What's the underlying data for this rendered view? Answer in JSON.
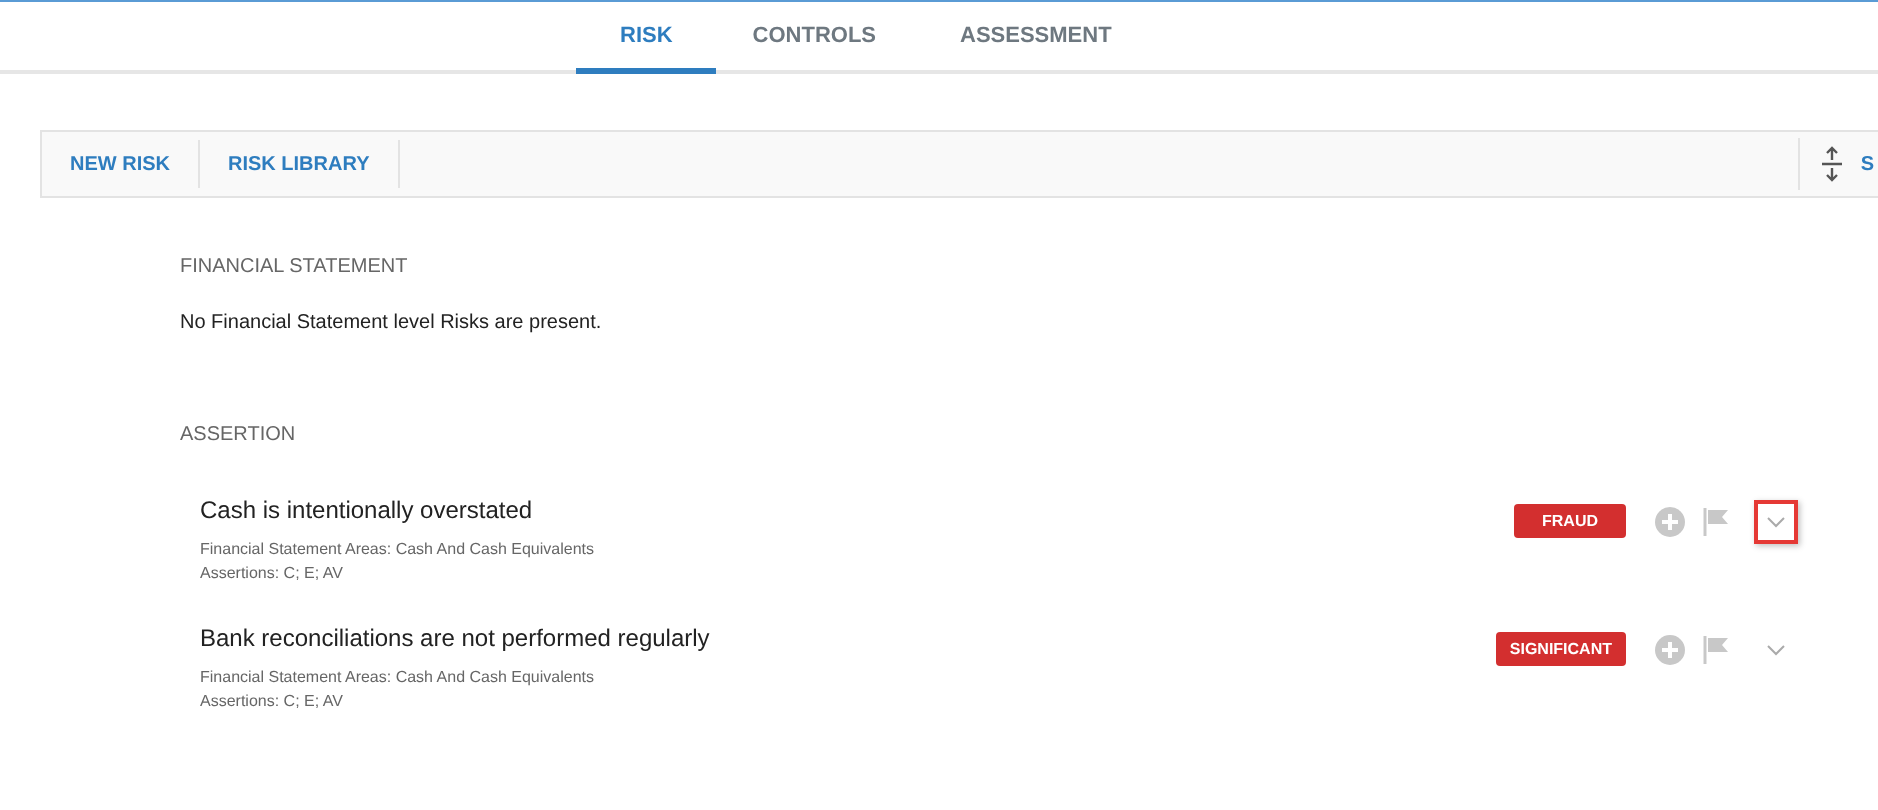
{
  "tabs": [
    {
      "label": "RISK",
      "selected": true
    },
    {
      "label": "CONTROLS",
      "selected": false
    },
    {
      "label": "ASSESSMENT",
      "selected": false
    }
  ],
  "toolbar": {
    "actions": [
      "NEW RISK",
      "RISK LIBRARY"
    ],
    "right_label": "S"
  },
  "financial_statement": {
    "heading": "FINANCIAL STATEMENT",
    "message": "No Financial Statement level Risks are present."
  },
  "assertion": {
    "heading": "ASSERTION",
    "risks": [
      {
        "title": "Cash is intentionally overstated",
        "areas": "Financial Statement Areas: Cash And Cash Equivalents",
        "assertions": "Assertions: C; E; AV",
        "badge": "FRAUD",
        "highlighted": true
      },
      {
        "title": "Bank reconciliations are not performed regularly",
        "areas": "Financial Statement Areas: Cash And Cash Equivalents",
        "assertions": "Assertions: C; E; AV",
        "badge": "SIGNIFICANT",
        "highlighted": false
      }
    ]
  }
}
